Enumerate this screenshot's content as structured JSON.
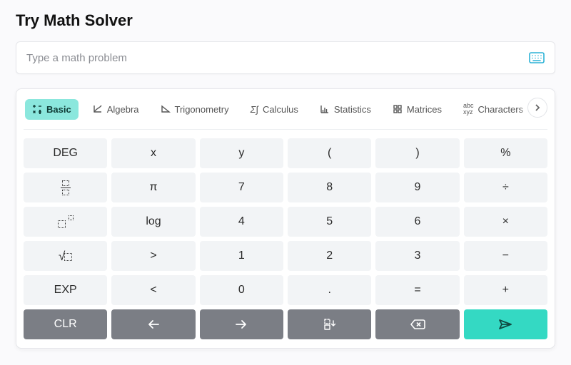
{
  "title": "Try Math Solver",
  "input": {
    "placeholder": "Type a math problem",
    "value": ""
  },
  "tabs": {
    "active_index": 0,
    "items": [
      {
        "label": "Basic"
      },
      {
        "label": "Algebra"
      },
      {
        "label": "Trigonometry"
      },
      {
        "label": "Calculus"
      },
      {
        "label": "Statistics"
      },
      {
        "label": "Matrices"
      },
      {
        "label": "Characters"
      }
    ]
  },
  "keys": {
    "row1": [
      "DEG",
      "x",
      "y",
      "(",
      ")",
      "%"
    ],
    "row2": [
      "fraction",
      "π",
      "7",
      "8",
      "9",
      "÷"
    ],
    "row3": [
      "exponent",
      "log",
      "4",
      "5",
      "6",
      "×"
    ],
    "row4": [
      "sqrt",
      ">",
      "1",
      "2",
      "3",
      "−"
    ],
    "row5": [
      "EXP",
      "<",
      "0",
      ".",
      "=",
      "+"
    ],
    "row6": [
      "CLR",
      "arrow-left",
      "arrow-right",
      "move-down",
      "backspace",
      "send"
    ]
  }
}
